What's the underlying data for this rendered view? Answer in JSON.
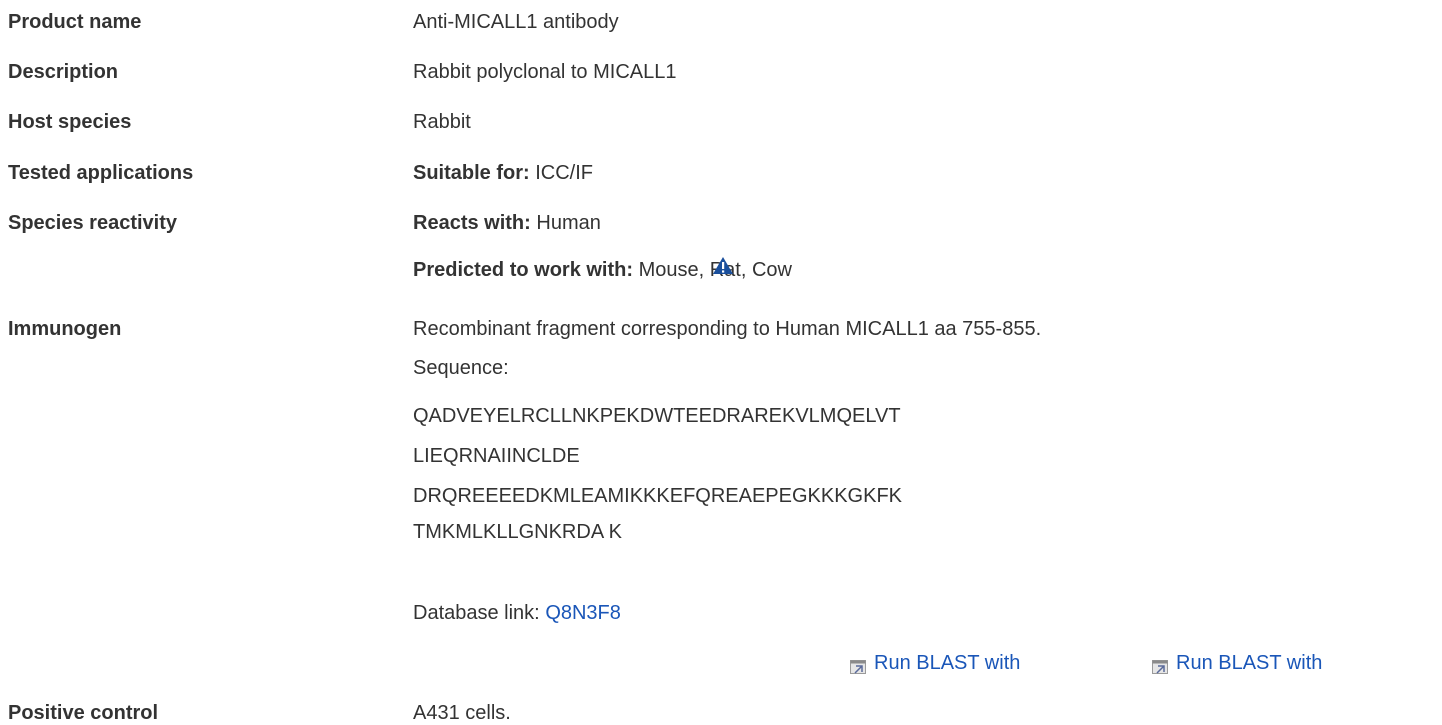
{
  "rows": {
    "product_name": {
      "label": "Product name",
      "value": "Anti-MICALL1 antibody"
    },
    "description": {
      "label": "Description",
      "value": "Rabbit polyclonal to MICALL1"
    },
    "host_species": {
      "label": "Host species",
      "value": "Rabbit"
    },
    "tested_applications": {
      "label": "Tested applications",
      "prefix": "Suitable for:",
      "value": "ICC/IF"
    },
    "species_reactivity": {
      "label": "Species reactivity",
      "reacts_prefix": "Reacts with:",
      "reacts_value": "Human",
      "predicted_prefix": "Predicted to work with:",
      "predicted_value": "Mouse, Rat, Cow",
      "warning_icon": "warning-triangle-icon"
    },
    "immunogen": {
      "label": "Immunogen",
      "text": "Recombinant fragment corresponding to Human MICALL1 aa 755-855.",
      "sequence_label": "Sequence:",
      "sequence_lines": [
        "QADVEYELRCLLNKPEKDWTEEDRAREKVLMQELVT",
        "LIEQRNAIINCLDE",
        "DRQREEEEDKMLEAMIKKKEFQREAEPEGKKKGKFK",
        "TMKMLKLLGNKRDA K"
      ],
      "database_label": "Database link:",
      "database_link": "Q8N3F8",
      "blast_links": [
        "Run BLAST with",
        "Run BLAST with"
      ]
    },
    "positive_control": {
      "label": "Positive control",
      "value": "A431 cells."
    }
  },
  "colors": {
    "text": "#333333",
    "link": "#1a56b8",
    "warning": "#1a4f9c"
  }
}
